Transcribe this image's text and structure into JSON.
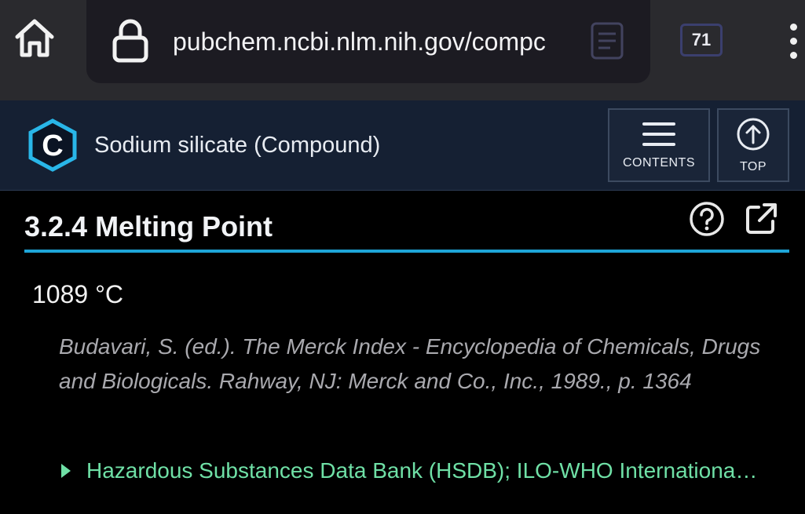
{
  "browser": {
    "url": "pubchem.ncbi.nlm.nih.gov/compc",
    "tab_count": "71",
    "icons": {
      "home": "home-icon",
      "lock": "lock-icon",
      "reader": "reader-view-icon",
      "menu": "kebab-menu-icon"
    }
  },
  "header": {
    "logo_letter": "C",
    "title": "Sodium silicate (Compound)",
    "contents_label": "CONTENTS",
    "top_label": "TOP",
    "accent_color": "#1ea5d8"
  },
  "section": {
    "title": "3.2.4 Melting Point",
    "value": "1089 °C",
    "citation": "Budavari, S. (ed.). The Merck Index - Encyclopedia of Chemicals, Drugs and Biologicals. Rahway, NJ: Merck and Co., Inc., 1989., p. 1364",
    "source_link": "Hazardous Substances Data Bank (HSDB); ILO-WHO International Chemical Safety Cards (ICSCs)",
    "link_color": "#6fe0a6"
  }
}
